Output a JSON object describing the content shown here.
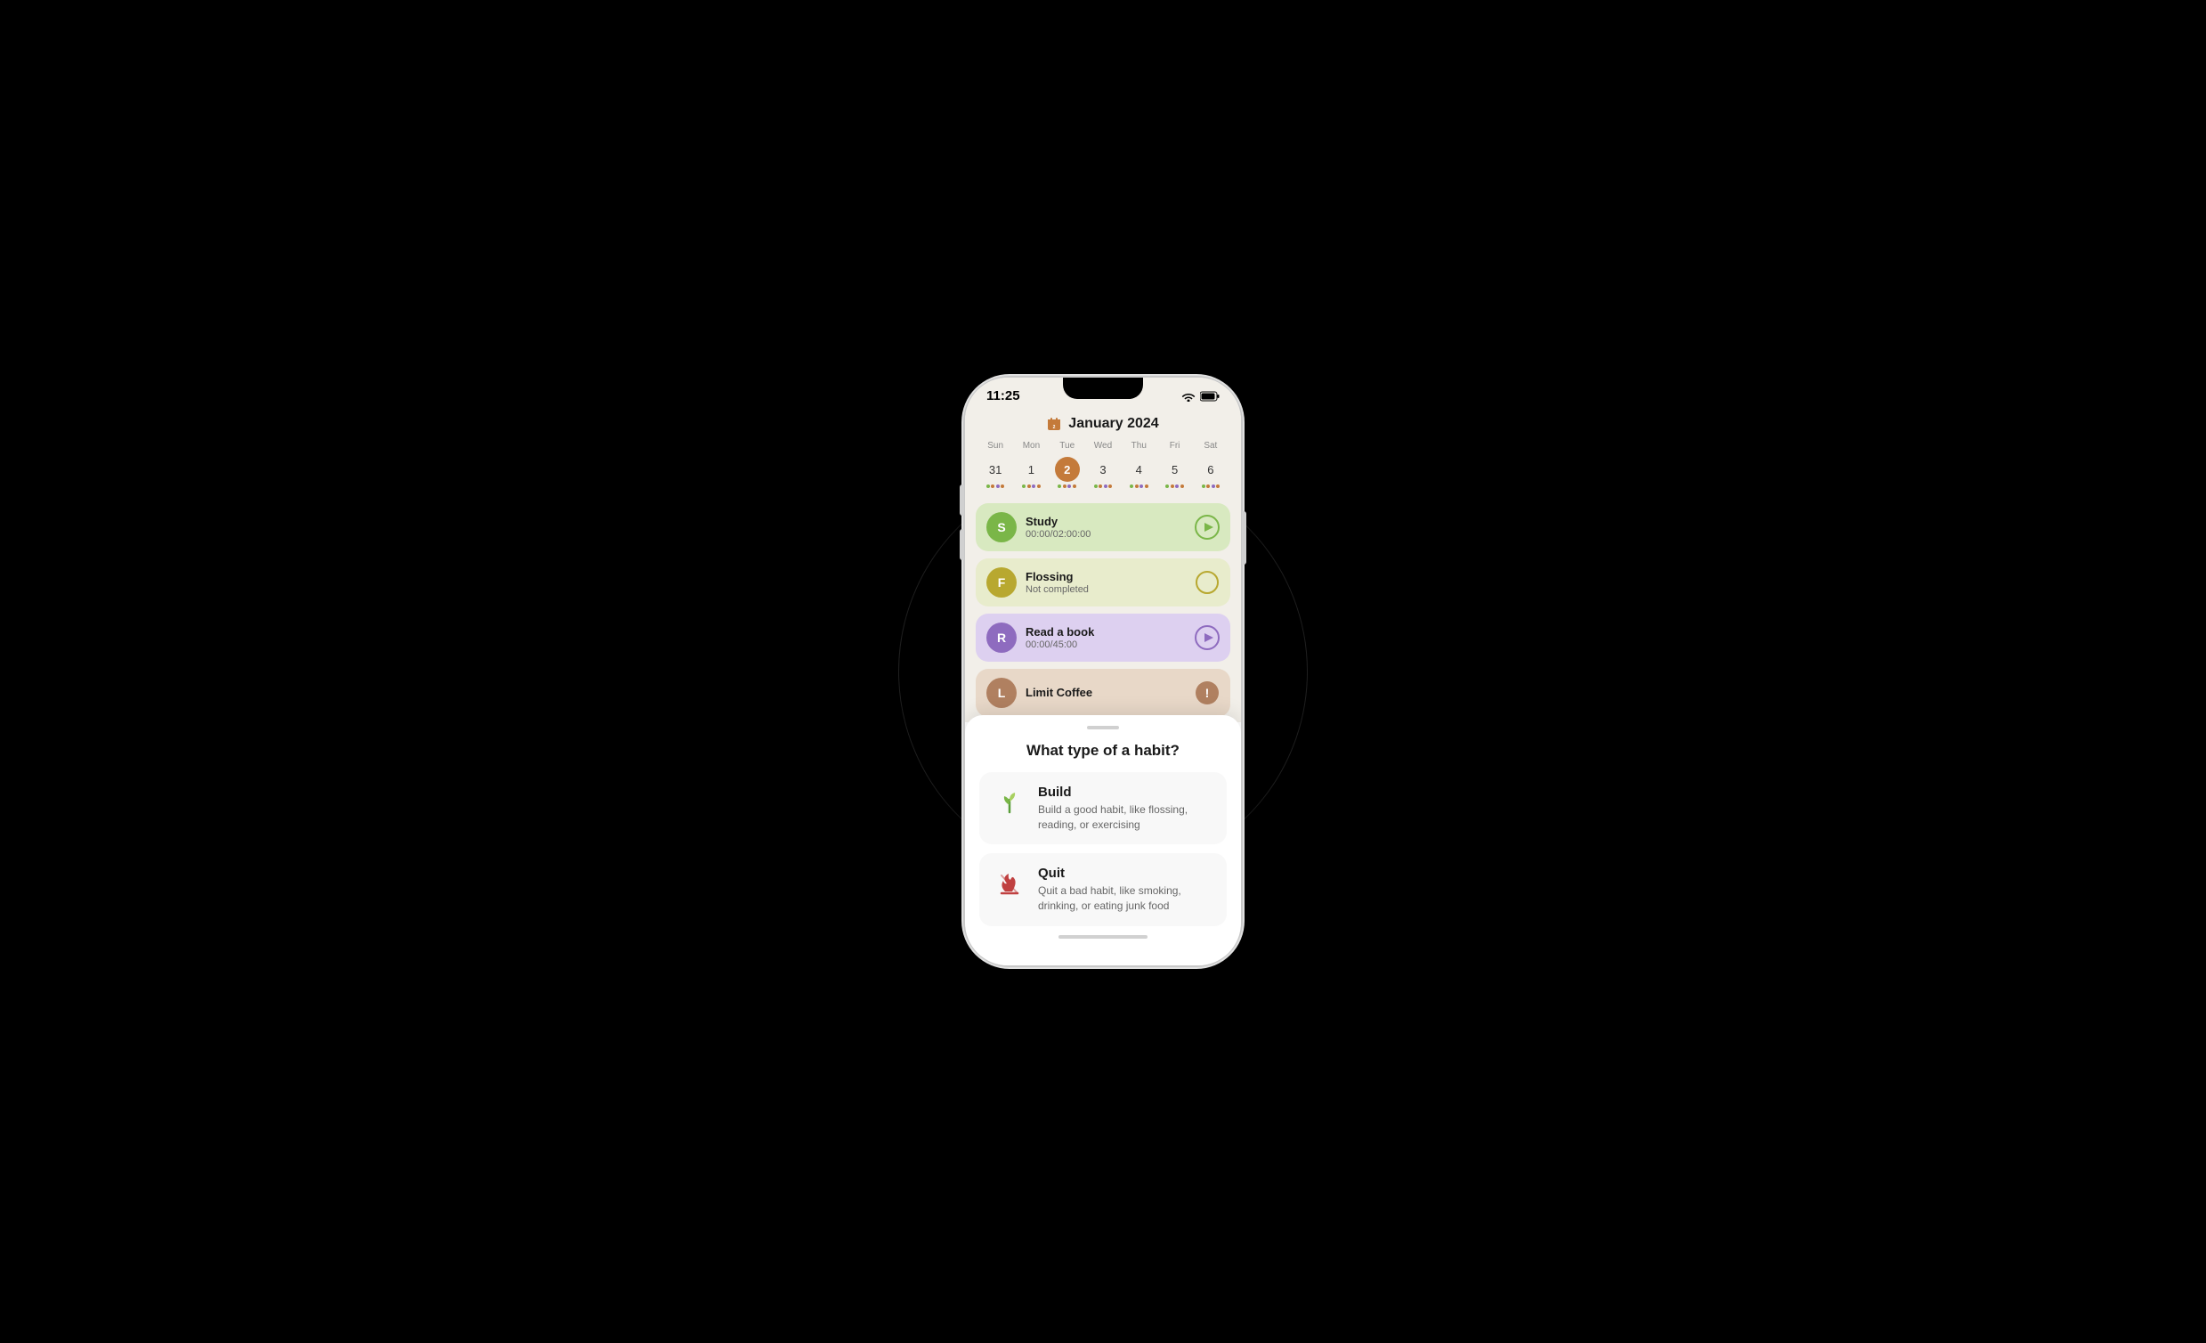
{
  "phone": {
    "status_bar": {
      "time": "11:25",
      "wifi_icon": "wifi",
      "battery_icon": "battery"
    },
    "calendar": {
      "title": "January 2024",
      "calendar_icon": "📅",
      "day_labels": [
        "Sun",
        "Mon",
        "Tue",
        "Wed",
        "Thu",
        "Fri",
        "Sat"
      ],
      "days": [
        {
          "date": "31",
          "today": false,
          "dots": [
            "#7ab648",
            "#c47a3a",
            "#8e6bbf",
            "#c47a3a"
          ]
        },
        {
          "date": "1",
          "today": false,
          "dots": [
            "#7ab648",
            "#c47a3a",
            "#8e6bbf",
            "#c47a3a"
          ]
        },
        {
          "date": "2",
          "today": true,
          "dots": [
            "#7ab648",
            "#c47a3a",
            "#8e6bbf",
            "#c47a3a"
          ]
        },
        {
          "date": "3",
          "today": false,
          "dots": [
            "#7ab648",
            "#c47a3a",
            "#8e6bbf",
            "#c47a3a"
          ]
        },
        {
          "date": "4",
          "today": false,
          "dots": [
            "#7ab648",
            "#c47a3a",
            "#8e6bbf",
            "#c47a3a"
          ]
        },
        {
          "date": "5",
          "today": false,
          "dots": [
            "#7ab648",
            "#c47a3a",
            "#8e6bbf",
            "#c47a3a"
          ]
        },
        {
          "date": "6",
          "today": false,
          "dots": [
            "#7ab648",
            "#c47a3a",
            "#8e6bbf",
            "#c47a3a"
          ]
        }
      ]
    },
    "habits": [
      {
        "letter": "S",
        "name": "Study",
        "sub": "00:00/02:00:00",
        "bg": "#d8e9c0",
        "avatar_color": "#7ab648",
        "action": "play",
        "action_color": "#7ab648"
      },
      {
        "letter": "F",
        "name": "Flossing",
        "sub": "Not completed",
        "bg": "#e8eccc",
        "avatar_color": "#b8a830",
        "action": "circle",
        "action_color": "#b8a830"
      },
      {
        "letter": "R",
        "name": "Read a book",
        "sub": "00:00/45:00",
        "bg": "#ddd0f0",
        "avatar_color": "#8e6bbf",
        "action": "play",
        "action_color": "#8e6bbf"
      },
      {
        "letter": "L",
        "name": "Limit Coffee",
        "sub": "",
        "bg": "#e8d8c8",
        "avatar_color": "#b08060",
        "action": "info",
        "action_color": "#b08060"
      }
    ]
  },
  "bottom_sheet": {
    "handle_label": "drag handle",
    "title": "What type of a habit?",
    "types": [
      {
        "id": "build",
        "icon": "sprout",
        "name": "Build",
        "description": "Build a good habit, like flossing, reading, or exercising"
      },
      {
        "id": "quit",
        "icon": "flame-quit",
        "name": "Quit",
        "description": "Quit a bad habit, like smoking, drinking, or eating junk food"
      }
    ]
  }
}
